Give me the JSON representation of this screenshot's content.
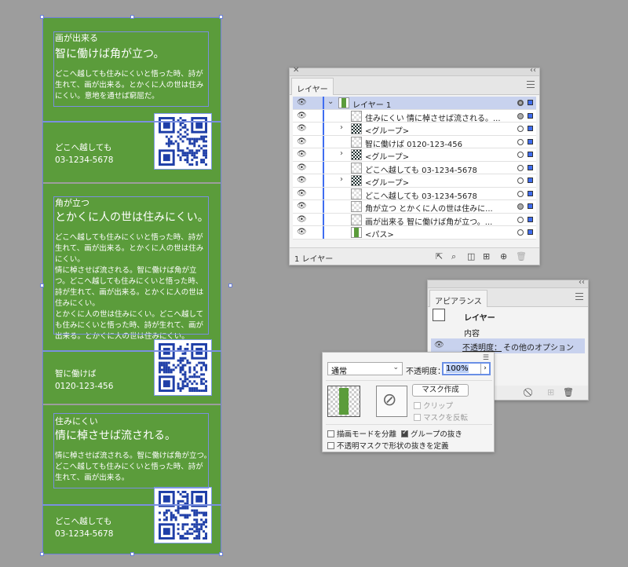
{
  "canvas": {
    "cards": [
      {
        "subtitle": "画が出来る",
        "title": "智に働けば角が立つ。",
        "body": [
          "どこへ越しても住みにくいと悟った時、詩が",
          "生れて、画が出来る。とかくに人の世は住み",
          "にくい。意地を通せば窮屈だ。"
        ],
        "contact_name": "どこへ越しても",
        "contact_phone": "03-1234-5678"
      },
      {
        "subtitle": "角が立つ",
        "title": "とかくに人の世は住みにくい。",
        "body": [
          "どこへ越しても住みにくいと悟った時、詩が",
          "生れて、画が出来る。とかくに人の世は住み",
          "にくい。",
          "情に棹させば流される。智に働けば角が立",
          "つ。どこへ越しても住みにくいと悟った時、",
          "詩が生れて、画が出来る。とかくに人の世は",
          "住みにくい。",
          "とかくに人の世は住みにくい。どこへ越して",
          "も住みにくいと悟った時、詩が生れて、画が",
          "出来る。とかくに人の世は住みにくい。"
        ],
        "contact_name": "智に働けば",
        "contact_phone": "0120-123-456"
      },
      {
        "subtitle": "住みにくい",
        "title": "情に棹させば流される。",
        "body": [
          "情に棹させば流される。智に働けば角が立つ。",
          "どこへ越しても住みにくいと悟った時、詩が",
          "生れて、画が出来る。"
        ],
        "contact_name": "どこへ越しても",
        "contact_phone": "03-1234-5678"
      }
    ]
  },
  "layers_panel": {
    "tab": "レイヤー",
    "rows": [
      {
        "name": "レイヤー 1"
      },
      {
        "name": "住みにくい 情に棹させば流される。..."
      },
      {
        "name": "<グループ>"
      },
      {
        "name": "智に働けば 0120-123-456"
      },
      {
        "name": "<グループ>"
      },
      {
        "name": "どこへ越しても 03-1234-5678"
      },
      {
        "name": "<グループ>"
      },
      {
        "name": "どこへ越しても 03-1234-5678"
      },
      {
        "name": "角が立つ とかくに人の世は住みに..."
      },
      {
        "name": "画が出来る 智に働けば角が立つ。..."
      },
      {
        "name": "<パス>"
      }
    ],
    "footer_count": "1 レイヤー"
  },
  "appearance_panel": {
    "tab": "アピアランス",
    "target": "レイヤー",
    "contents": "内容",
    "opacity_label": "不透明度：",
    "opacity_value": "その他のオプション"
  },
  "transparency_panel": {
    "blend_mode": "通常",
    "opacity_label": "不透明度：",
    "opacity_value": "100%",
    "make_mask": "マスク作成",
    "clip": "クリップ",
    "invert_mask": "マスクを反転",
    "isolate_blending": "描画モードを分離",
    "knockout_group": "グループの抜き",
    "opacity_mask_define": "不透明マスクで形状の抜きを定義"
  },
  "colors": {
    "card_green": "#5b9c3b",
    "selection_blue": "#3f6df0",
    "canvas_gray": "#9d9d9d"
  }
}
